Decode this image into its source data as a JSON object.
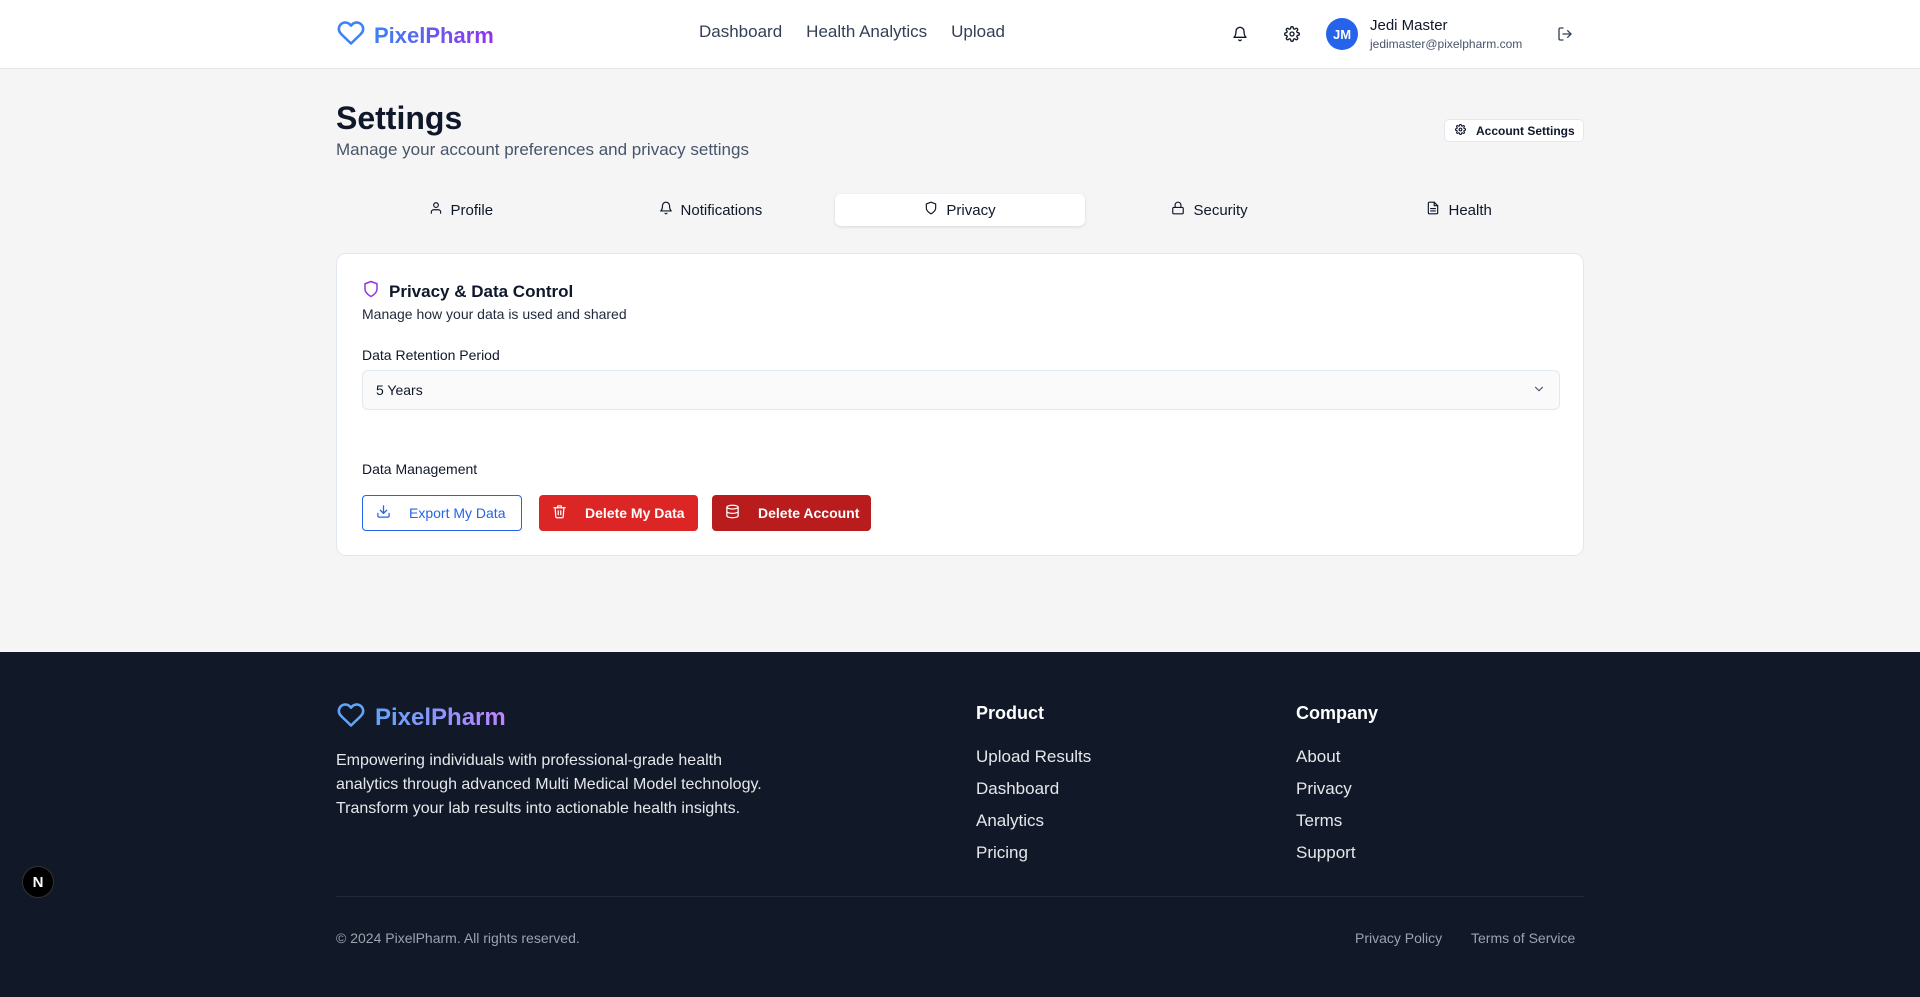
{
  "header": {
    "brand": "PixelPharm",
    "nav": [
      "Dashboard",
      "Health Analytics",
      "Upload"
    ],
    "user": {
      "initials": "JM",
      "name": "Jedi Master",
      "email": "jedimaster@pixelpharm.com"
    },
    "icons": [
      "bell-icon",
      "gear-icon",
      "logout-icon"
    ]
  },
  "page": {
    "title": "Settings",
    "subtitle": "Manage your account preferences and privacy settings",
    "account_settings_label": "Account Settings"
  },
  "tabs": [
    {
      "label": "Profile",
      "icon": "user-icon",
      "active": false
    },
    {
      "label": "Notifications",
      "icon": "bell-icon",
      "active": false
    },
    {
      "label": "Privacy",
      "icon": "shield-icon",
      "active": true
    },
    {
      "label": "Security",
      "icon": "lock-icon",
      "active": false
    },
    {
      "label": "Health",
      "icon": "document-icon",
      "active": false
    }
  ],
  "privacy_card": {
    "title": "Privacy & Data Control",
    "description": "Manage how your data is used and shared",
    "retention_label": "Data Retention Period",
    "retention_value": "5 Years",
    "management_label": "Data Management",
    "export_label": "Export My Data",
    "delete_data_label": "Delete My Data",
    "delete_account_label": "Delete Account"
  },
  "footer": {
    "brand": "PixelPharm",
    "description": "Empowering individuals with professional-grade health analytics through advanced Multi Medical Model technology. Transform your lab results into actionable health insights.",
    "product_heading": "Product",
    "product_links": [
      "Upload Results",
      "Dashboard",
      "Analytics",
      "Pricing"
    ],
    "company_heading": "Company",
    "company_links": [
      "About",
      "Privacy",
      "Terms",
      "Support"
    ],
    "copyright": "© 2024 PixelPharm. All rights reserved.",
    "privacy_policy": "Privacy Policy",
    "terms_of_service": "Terms of Service"
  },
  "dev_badge": "N",
  "colors": {
    "brand_blue": "#3b82f6",
    "brand_purple": "#9333ea",
    "danger": "#dc2626",
    "danger_dark": "#b91c1c",
    "footer_bg": "#111827"
  }
}
